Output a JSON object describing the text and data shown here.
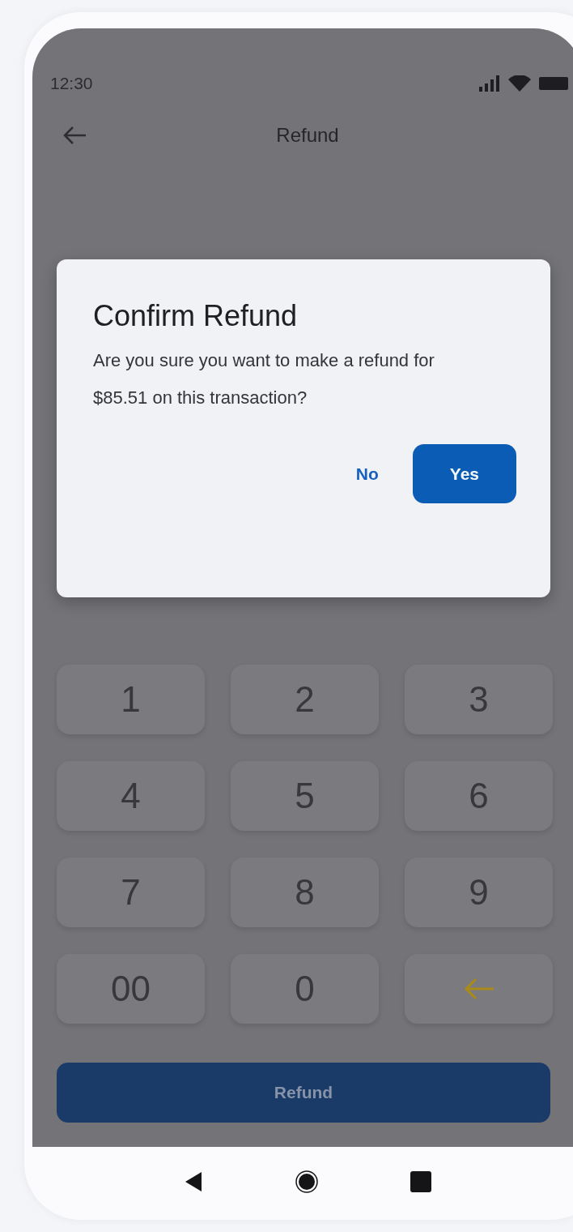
{
  "status_bar": {
    "time": "12:30"
  },
  "header": {
    "title": "Refund"
  },
  "dialog": {
    "title": "Confirm Refund",
    "message": "Are you sure you want to make a refund for $85.51 on this transaction?",
    "buttons": [
      {
        "label": "No",
        "kind": "text"
      },
      {
        "label": "Yes",
        "kind": "filled"
      }
    ]
  },
  "keypad": {
    "keys": [
      {
        "kind": "digit",
        "label": "1"
      },
      {
        "kind": "digit",
        "label": "2"
      },
      {
        "kind": "digit",
        "label": "3"
      },
      {
        "kind": "digit",
        "label": "4"
      },
      {
        "kind": "digit",
        "label": "5"
      },
      {
        "kind": "digit",
        "label": "6"
      },
      {
        "kind": "digit",
        "label": "7"
      },
      {
        "kind": "digit",
        "label": "8"
      },
      {
        "kind": "digit",
        "label": "9"
      },
      {
        "kind": "digit",
        "label": "00"
      },
      {
        "kind": "digit",
        "label": "0"
      },
      {
        "kind": "backspace"
      }
    ]
  },
  "primary_button": {
    "label": "Refund"
  }
}
